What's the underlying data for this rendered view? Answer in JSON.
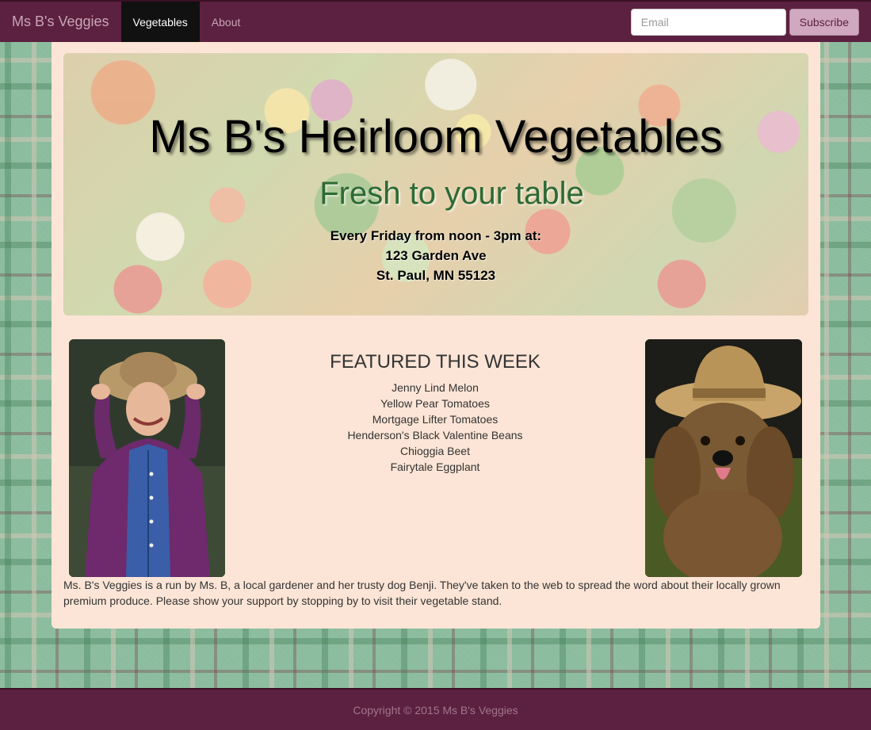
{
  "navbar": {
    "brand": "Ms B's Veggies",
    "items": [
      {
        "label": "Vegetables",
        "active": true
      },
      {
        "label": "About",
        "active": false
      }
    ],
    "email_placeholder": "Email",
    "subscribe_label": "Subscribe"
  },
  "hero": {
    "title": "Ms B's Heirloom Vegetables",
    "subtitle": "Fresh to your table",
    "info_lines": [
      "Every Friday from noon - 3pm at:",
      "123 Garden Ave",
      "St. Paul, MN 55123"
    ]
  },
  "featured": {
    "heading": "FEATURED THIS WEEK",
    "items": [
      "Jenny Lind Melon",
      "Yellow Pear Tomatoes",
      "Mortgage Lifter Tomatoes",
      "Henderson's Black Valentine Beans",
      "Chioggia Beet",
      "Fairytale Eggplant"
    ]
  },
  "about": {
    "text": "Ms. B's Veggies is a run by Ms. B, a local gardener and her trusty dog Benji. They've taken to the web to spread the word about their locally grown premium produce. Please show your support by stopping by to visit their vegetable stand."
  },
  "footer": {
    "copyright": "Copyright © 2015 Ms B's Veggies"
  },
  "colors": {
    "navbar": "#5c2040",
    "panel": "#fce5d6",
    "subtitle_green": "#2d6a34",
    "subscribe_button": "#d0a8c0"
  }
}
